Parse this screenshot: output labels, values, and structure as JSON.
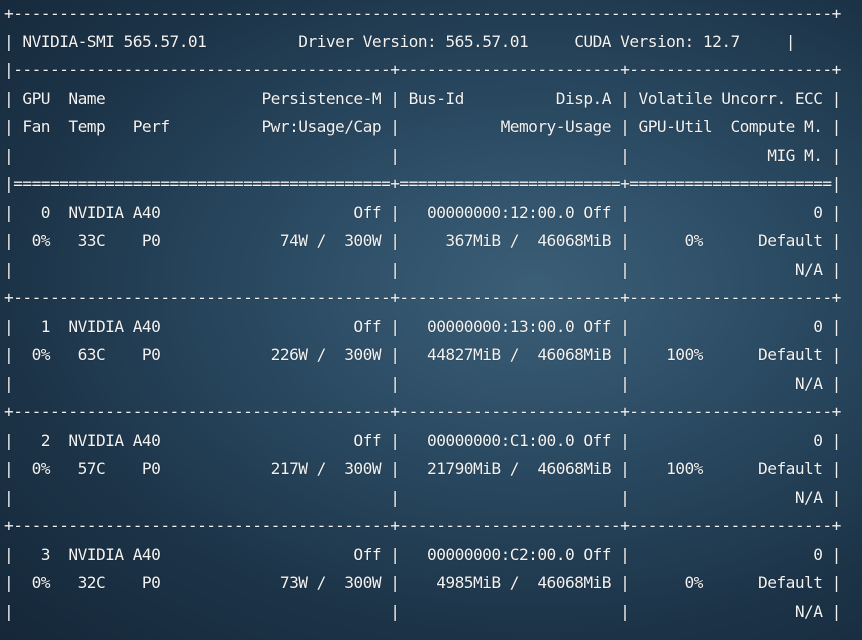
{
  "smi": {
    "title": "NVIDIA-SMI 565.57.01",
    "driver": "Driver Version: 565.57.01",
    "cuda": "CUDA Version: 12.7"
  },
  "table": {
    "border": "+-----------------------------------------------------------------------------------------+",
    "header_sep": "|-----------------------------------------+------------------------+----------------------+",
    "header_row1": "| GPU  Name                 Persistence-M | Bus-Id          Disp.A | Volatile Uncorr. ECC |",
    "header_row2": "| Fan  Temp   Perf          Pwr:Usage/Cap |           Memory-Usage | GPU-Util  Compute M. |",
    "header_row3": "|                                         |                        |               MIG M. |",
    "double_sep": "|=========================================+========================+======================|",
    "gpu_sep": "+-----------------------------------------+------------------------+----------------------+"
  },
  "gpus": [
    {
      "row1": "|   0  NVIDIA A40                     Off |   00000000:12:00.0 Off |                    0 |",
      "row2": "|  0%   33C    P0             74W /  300W |     367MiB /  46068MiB |      0%      Default |",
      "row3": "|                                         |                        |                  N/A |"
    },
    {
      "row1": "|   1  NVIDIA A40                     Off |   00000000:13:00.0 Off |                    0 |",
      "row2": "|  0%   63C    P0            226W /  300W |   44827MiB /  46068MiB |    100%      Default |",
      "row3": "|                                         |                        |                  N/A |"
    },
    {
      "row1": "|   2  NVIDIA A40                     Off |   00000000:C1:00.0 Off |                    0 |",
      "row2": "|  0%   57C    P0            217W /  300W |   21790MiB /  46068MiB |    100%      Default |",
      "row3": "|                                         |                        |                  N/A |"
    },
    {
      "row1": "|   3  NVIDIA A40                     Off |   00000000:C2:00.0 Off |                    0 |",
      "row2": "|  0%   32C    P0             73W /  300W |    4985MiB /  46068MiB |      0%      Default |",
      "row3": "|                                         |                        |                  N/A |"
    }
  ]
}
